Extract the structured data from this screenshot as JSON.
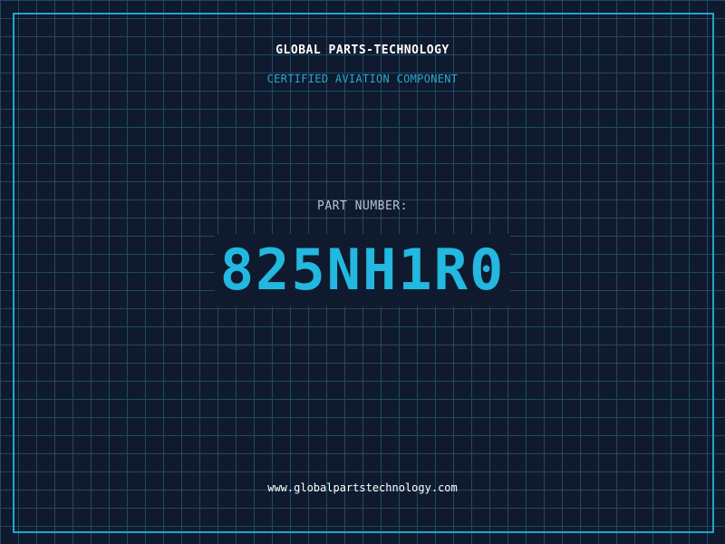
{
  "header": {
    "company": "GLOBAL PARTS-TECHNOLOGY",
    "tagline": "CERTIFIED AVIATION COMPONENT"
  },
  "part": {
    "label": "PART NUMBER:",
    "number": "825NH1R0"
  },
  "footer": {
    "website": "www.globalpartstechnology.com"
  },
  "colors": {
    "background": "#0f1a2e",
    "grid": "#1e4a63",
    "accent": "#22b8e0",
    "frame": "#1fa6c8"
  }
}
